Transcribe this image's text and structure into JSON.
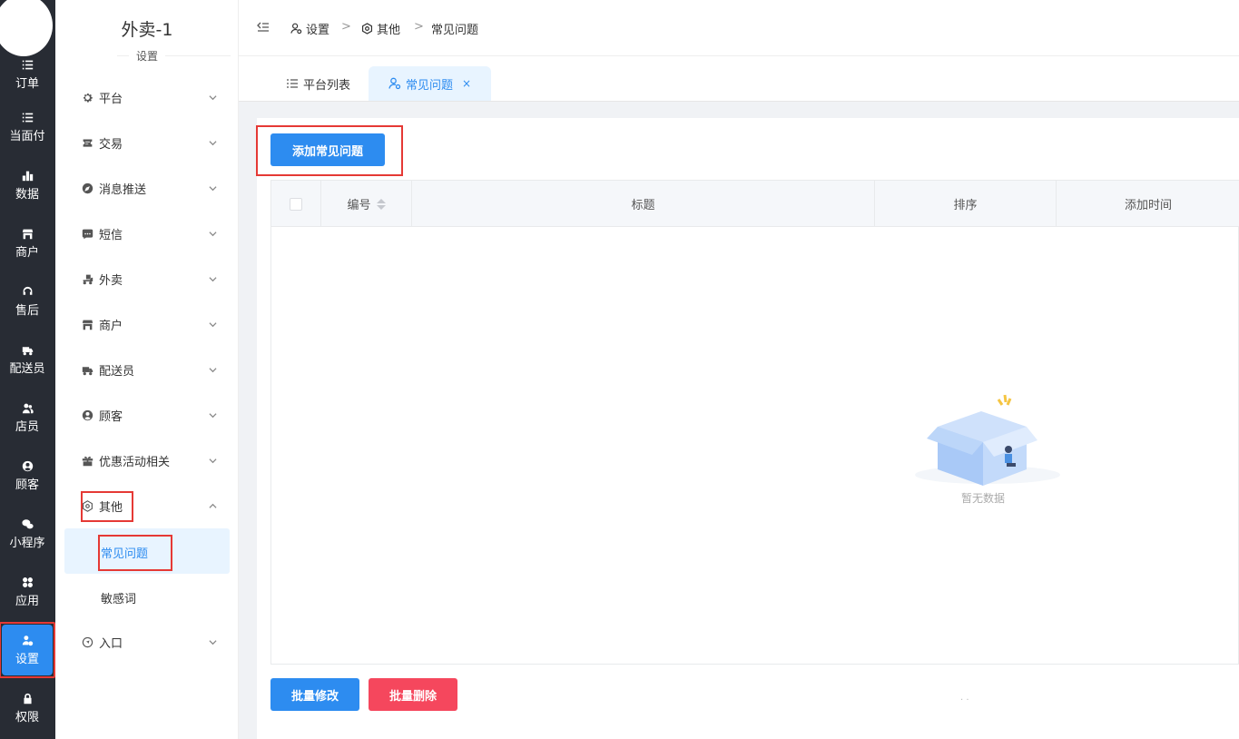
{
  "rail": {
    "items": [
      {
        "label": "订单",
        "icon": "list-icon"
      },
      {
        "label": "当面付",
        "icon": "list-icon"
      },
      {
        "label": "数据",
        "icon": "bar-chart-icon"
      },
      {
        "label": "商户",
        "icon": "store-icon"
      },
      {
        "label": "售后",
        "icon": "headset-icon"
      },
      {
        "label": "配送员",
        "icon": "delivery-truck-icon"
      },
      {
        "label": "店员",
        "icon": "users-icon"
      },
      {
        "label": "顾客",
        "icon": "user-circle-icon"
      },
      {
        "label": "小程序",
        "icon": "wechat-icon"
      },
      {
        "label": "应用",
        "icon": "apps-grid-icon"
      },
      {
        "label": "设置",
        "icon": "user-gear-icon"
      },
      {
        "label": "权限",
        "icon": "lock-icon"
      }
    ],
    "active_index": 10,
    "active_color": "#2d8cf0"
  },
  "submenu": {
    "title": "外卖-1",
    "subtitle": "设置",
    "items": [
      {
        "label": "平台",
        "icon": "gear-icon"
      },
      {
        "label": "交易",
        "icon": "ticket-icon"
      },
      {
        "label": "消息推送",
        "icon": "compass-icon"
      },
      {
        "label": "短信",
        "icon": "sms-icon"
      },
      {
        "label": "外卖",
        "icon": "delivery-bike-icon"
      },
      {
        "label": "商户",
        "icon": "store-icon"
      },
      {
        "label": "配送员",
        "icon": "delivery-truck-icon"
      },
      {
        "label": "顾客",
        "icon": "user-circle-icon"
      },
      {
        "label": "优惠活动相关",
        "icon": "gift-icon"
      },
      {
        "label": "其他",
        "icon": "hexagon-gear-icon"
      },
      {
        "label": "入口",
        "icon": "navigation-icon"
      }
    ],
    "children": {
      "faq": "常见问题",
      "sensitive": "敏感词"
    }
  },
  "header": {
    "breadcrumb": [
      "设置",
      "其他",
      "常见问题"
    ],
    "separator": ">"
  },
  "tabs": [
    {
      "label": "平台列表",
      "active": false
    },
    {
      "label": "常见问题",
      "active": true,
      "close": "×"
    }
  ],
  "toolbar": {
    "add_label": "添加常见问题",
    "batch_edit_label": "批量修改",
    "batch_delete_label": "批量删除"
  },
  "table": {
    "columns": [
      "编号",
      "标题",
      "排序",
      "添加时间"
    ],
    "empty_text": "暂无数据",
    "pager_dots": "· ·"
  },
  "colors": {
    "primary": "#2d8cf0",
    "danger": "#f5475d",
    "highlight": "#e53935"
  }
}
